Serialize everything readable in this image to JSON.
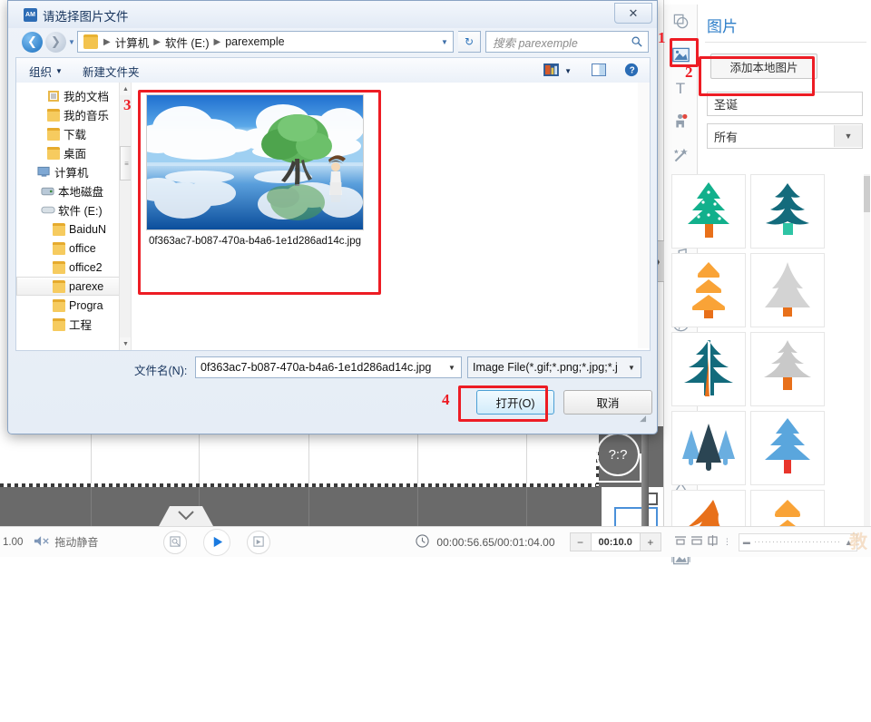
{
  "dialog": {
    "title": "请选择图片文件",
    "app_icon_text": "AM",
    "close_label": "✕",
    "breadcrumb": [
      "计算机",
      "软件 (E:)",
      "parexemple"
    ],
    "search_placeholder": "搜索 parexemple",
    "search_icon": "search-icon",
    "refresh_icon": "refresh-icon",
    "commandbar": {
      "organize": "组织",
      "new_folder": "新建文件夹",
      "view_icon": "view-mode-icon",
      "preview_icon": "preview-pane-icon",
      "help_icon": "help-icon"
    },
    "tree": [
      {
        "label": "我的文档",
        "icon": "documents-icon",
        "indent": 2,
        "selected": false
      },
      {
        "label": "我的音乐",
        "icon": "music-folder-icon",
        "indent": 2,
        "selected": false
      },
      {
        "label": "下载",
        "icon": "downloads-icon",
        "indent": 2,
        "selected": false
      },
      {
        "label": "桌面",
        "icon": "desktop-folder-icon",
        "indent": 2,
        "selected": false
      },
      {
        "label": "计算机",
        "icon": "computer-icon",
        "indent": 1,
        "selected": false
      },
      {
        "label": "本地磁盘",
        "icon": "harddisk-icon",
        "indent": 2,
        "selected": false
      },
      {
        "label": "软件 (E:)",
        "icon": "drive-icon",
        "indent": 2,
        "selected": false
      },
      {
        "label": "BaiduN",
        "icon": "folder-icon",
        "indent": 3,
        "selected": false
      },
      {
        "label": "office",
        "icon": "folder-icon",
        "indent": 3,
        "selected": false
      },
      {
        "label": "office2",
        "icon": "folder-icon",
        "indent": 3,
        "selected": false
      },
      {
        "label": "parexe",
        "icon": "folder-icon",
        "indent": 3,
        "selected": true
      },
      {
        "label": "Progra",
        "icon": "folder-icon",
        "indent": 3,
        "selected": false
      },
      {
        "label": "工程",
        "icon": "folder-icon",
        "indent": 3,
        "selected": false
      }
    ],
    "file_item": {
      "name": "0f363ac7-b087-470a-b4a6-1e1d286ad14c.jpg",
      "thumbnail_alt": "sky-clouds-tree-reflection-photo"
    },
    "filename_label": "文件名(N):",
    "filename_value": "0f363ac7-b087-470a-b4a6-1e1d286ad14c.jpg",
    "filetype_value": "Image File(*.gif;*.png;*.jpg;*.j",
    "open_button": "打开(O)",
    "cancel_button": "取消"
  },
  "right_panel": {
    "title": "图片",
    "add_local_button": "添加本地图片",
    "search_value": "圣诞",
    "search_icon": "search-icon",
    "filter_value": "所有",
    "filter_arrow_icon": "chevron-down-icon",
    "tools": [
      {
        "name": "shapes-icon",
        "glyph": "shape"
      },
      {
        "name": "image-icon",
        "glyph": "image",
        "active": true
      },
      {
        "name": "text-icon",
        "glyph": "T"
      },
      {
        "name": "character-icon",
        "glyph": "person"
      },
      {
        "name": "effects-wand-icon",
        "glyph": "wand"
      },
      {
        "name": "callout-icon",
        "glyph": "bubble"
      },
      {
        "name": "folder-icon",
        "glyph": "folder"
      },
      {
        "name": "music-icon",
        "glyph": "music"
      },
      {
        "name": "film-icon",
        "glyph": "film"
      },
      {
        "name": "formula-icon",
        "glyph": "f"
      },
      {
        "name": "plane-icon",
        "glyph": "plane"
      },
      {
        "name": "gesture-icon",
        "glyph": "gesture"
      },
      {
        "name": "pie-chart-icon",
        "glyph": "pie"
      },
      {
        "name": "sigma-icon",
        "glyph": "sigma"
      },
      {
        "name": "water-drop-icon",
        "glyph": "drop"
      },
      {
        "name": "archive-icon",
        "glyph": "archive"
      },
      {
        "name": "photo-frame-icon",
        "glyph": "photo"
      }
    ],
    "gallery": [
      {
        "name": "tree-green-dotted",
        "body": "#12b08c",
        "trunk": "#e8701a",
        "style": "layered-dots"
      },
      {
        "name": "tree-teal-bold",
        "body": "#136b7c",
        "trunk": "#2ec4a5",
        "style": "wavy"
      },
      {
        "name": "tree-orange-tiers",
        "body": "#f9a337",
        "trunk": "#e8701a",
        "style": "tiers"
      },
      {
        "name": "tree-gray-solid",
        "body": "#d3d3d3",
        "trunk": "#e8701a",
        "style": "solid"
      },
      {
        "name": "tree-teal-split",
        "body": "#136b7c",
        "trunk": "#e8701a",
        "style": "split"
      },
      {
        "name": "tree-gray-fir",
        "body": "#c9c9c9",
        "trunk": "#e8701a",
        "style": "fir"
      },
      {
        "name": "tree-blue-trio",
        "body": "#6aaee0",
        "trunk": "#2b4553",
        "style": "trio"
      },
      {
        "name": "tree-blue-layered",
        "body": "#5aa6dd",
        "trunk": "#e8352b",
        "style": "layered"
      },
      {
        "name": "tree-orange-stroke",
        "body": "#e8701a",
        "trunk": "#e8701a",
        "style": "brush"
      },
      {
        "name": "tree-orange-tiers-2",
        "body": "#f9a337",
        "trunk": "#e8701a",
        "style": "tiers"
      }
    ]
  },
  "bottom_bar": {
    "zoom_value": "1.00",
    "mute_icon": "mute-icon",
    "mute_label": "拖动静音",
    "snapshot_icon": "snapshot-icon",
    "play_icon": "play-icon",
    "next_frame_icon": "next-frame-icon",
    "clock_icon": "clock-icon",
    "time_display": "00:00:56.65/00:01:04.00",
    "duration_minus": "−",
    "duration_value": "00:10.0",
    "duration_plus": "+",
    "align_icons": [
      "align-a-icon",
      "align-b-icon",
      "align-c-icon",
      "align-d-icon"
    ],
    "zoom_slider_min_icon": "zoom-out-icon",
    "zoom_slider_max_icon": "zoom-in-icon"
  },
  "annotations": [
    {
      "number": "1",
      "target": "image-tool-icon"
    },
    {
      "number": "2",
      "target": "add-local-image-button"
    },
    {
      "number": "3",
      "target": "file-thumbnail"
    },
    {
      "number": "4",
      "target": "open-button"
    }
  ],
  "canvas": {
    "help_marker": "?:?",
    "collapse_icon": "chevron-right-icon",
    "expand_icon": "chevron-down-icon"
  }
}
